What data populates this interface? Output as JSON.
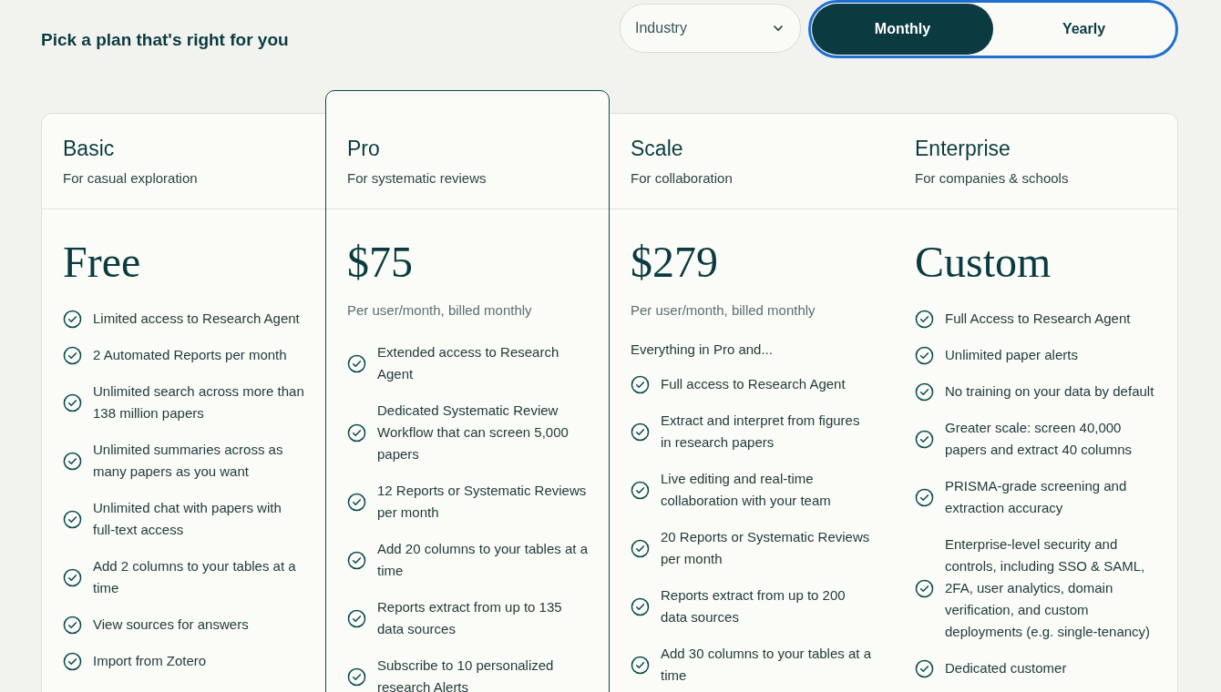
{
  "header": {
    "subtitle": "Pick a plan that's right for you"
  },
  "filter": {
    "value": "Industry"
  },
  "billing": [
    {
      "label": "Monthly",
      "selected": true
    },
    {
      "label": "Yearly",
      "selected": false
    }
  ],
  "plans": [
    {
      "name": "Basic",
      "tagline": "For casual exploration",
      "highlighted": false,
      "price": "Free",
      "features": [
        "Limited access to Research Agent",
        "2 Automated Reports per month",
        "Unlimited search across more than 138 million papers",
        "Unlimited summaries across as many papers as you want",
        "Unlimited chat with papers with full-text access",
        "Add 2 columns to your tables at a time",
        "View sources for answers",
        "Import from Zotero"
      ]
    },
    {
      "name": "Pro",
      "tagline": "For systematic reviews",
      "highlighted": true,
      "price": "$75",
      "billing_note": "Per user/month, billed monthly",
      "features": [
        "Extended access to Research Agent",
        "Dedicated Systematic Review Workflow that can screen 5,000 papers",
        "12 Reports or Systematic Reviews per month",
        "Add 20 columns to your tables at a time",
        "Reports extract from up to 135 data sources",
        "Subscribe to 10 personalized research Alerts"
      ]
    },
    {
      "name": "Scale",
      "tagline": "For collaboration",
      "highlighted": false,
      "price": "$279",
      "billing_note": "Per user/month, billed monthly",
      "intro": "Everything in Pro and...",
      "features": [
        "Full access to Research Agent",
        "Extract and interpret from figures in research papers",
        "Live editing and real-time collaboration with your team",
        "20 Reports or Systematic Reviews per month",
        "Reports extract from up to 200 data sources",
        "Add 30 columns to your tables at a time"
      ]
    },
    {
      "name": "Enterprise",
      "tagline": "For companies & schools",
      "highlighted": false,
      "price": "Custom",
      "features": [
        "Full Access to Research Agent",
        "Unlimited paper alerts",
        "No training on your data by default",
        "Greater scale: screen 40,000 papers and extract 40 columns",
        "PRISMA-grade screening and extraction accuracy",
        "Enterprise-level security and controls, including SSO & SAML, 2FA, user analytics, domain verification, and custom deployments (e.g. single-tenancy)",
        "Dedicated customer"
      ]
    }
  ]
}
